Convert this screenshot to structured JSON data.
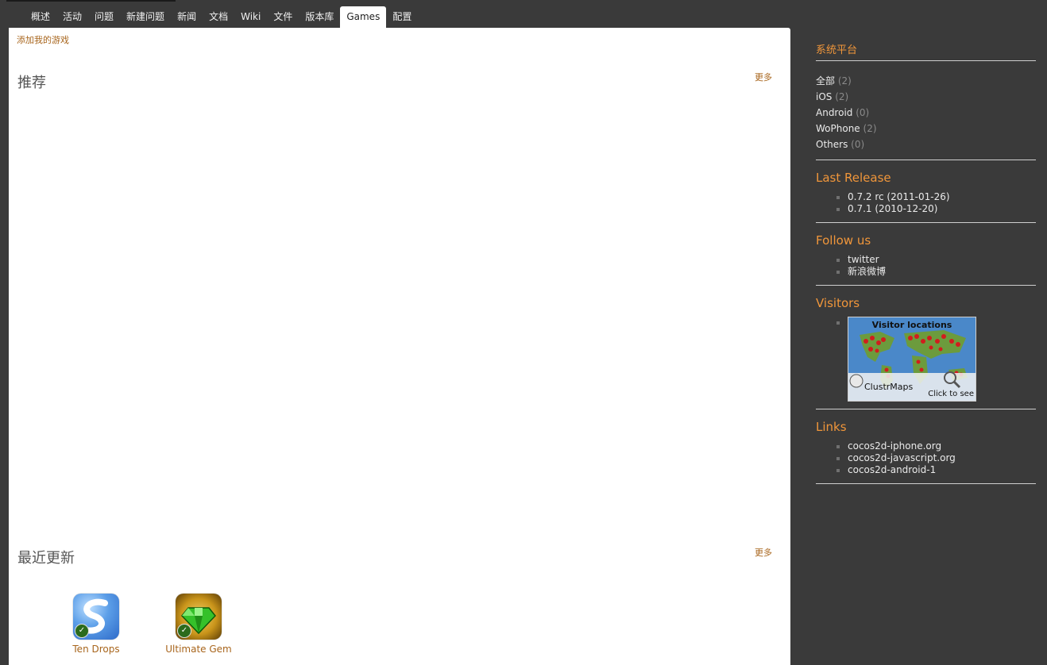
{
  "tabs": [
    {
      "label": "概述"
    },
    {
      "label": "活动"
    },
    {
      "label": "问题"
    },
    {
      "label": "新建问题"
    },
    {
      "label": "新闻"
    },
    {
      "label": "文档"
    },
    {
      "label": "Wiki"
    },
    {
      "label": "文件"
    },
    {
      "label": "版本库"
    },
    {
      "label": "Games",
      "active": true
    },
    {
      "label": "配置"
    }
  ],
  "main": {
    "add_game_link": "添加我的游戏",
    "featured": {
      "title": "推荐",
      "more": "更多"
    },
    "recent": {
      "title": "最近更新",
      "more": "更多"
    },
    "games": [
      {
        "name": "Ten Drops",
        "icon": "ten-drops-icon"
      },
      {
        "name": "Ultimate Gem",
        "icon": "ultimate-gem-icon"
      }
    ]
  },
  "sidebar": {
    "platforms": {
      "title": "系统平台",
      "items": [
        {
          "label": "全部",
          "count": "(2)"
        },
        {
          "label": "iOS",
          "count": "(2)"
        },
        {
          "label": "Android",
          "count": "(0)"
        },
        {
          "label": "WoPhone",
          "count": "(2)"
        },
        {
          "label": "Others",
          "count": "(0)"
        }
      ]
    },
    "last_release": {
      "title": "Last Release",
      "items": [
        "0.7.2 rc (2011-01-26)",
        "0.7.1 (2010-12-20)"
      ]
    },
    "follow": {
      "title": "Follow us",
      "items": [
        "twitter",
        "新浪微博"
      ]
    },
    "visitors": {
      "title": "Visitors",
      "map_title": "Visitor locations",
      "map_logo": "ClustrMaps",
      "map_cta": "Click to see"
    },
    "links": {
      "title": "Links",
      "items": [
        "cocos2d-iphone.org",
        "cocos2d-javascript.org",
        "cocos2d-android-1"
      ]
    }
  },
  "colors": {
    "accent": "#f0963a",
    "link": "#a8651c",
    "background": "#3a3a3a"
  }
}
